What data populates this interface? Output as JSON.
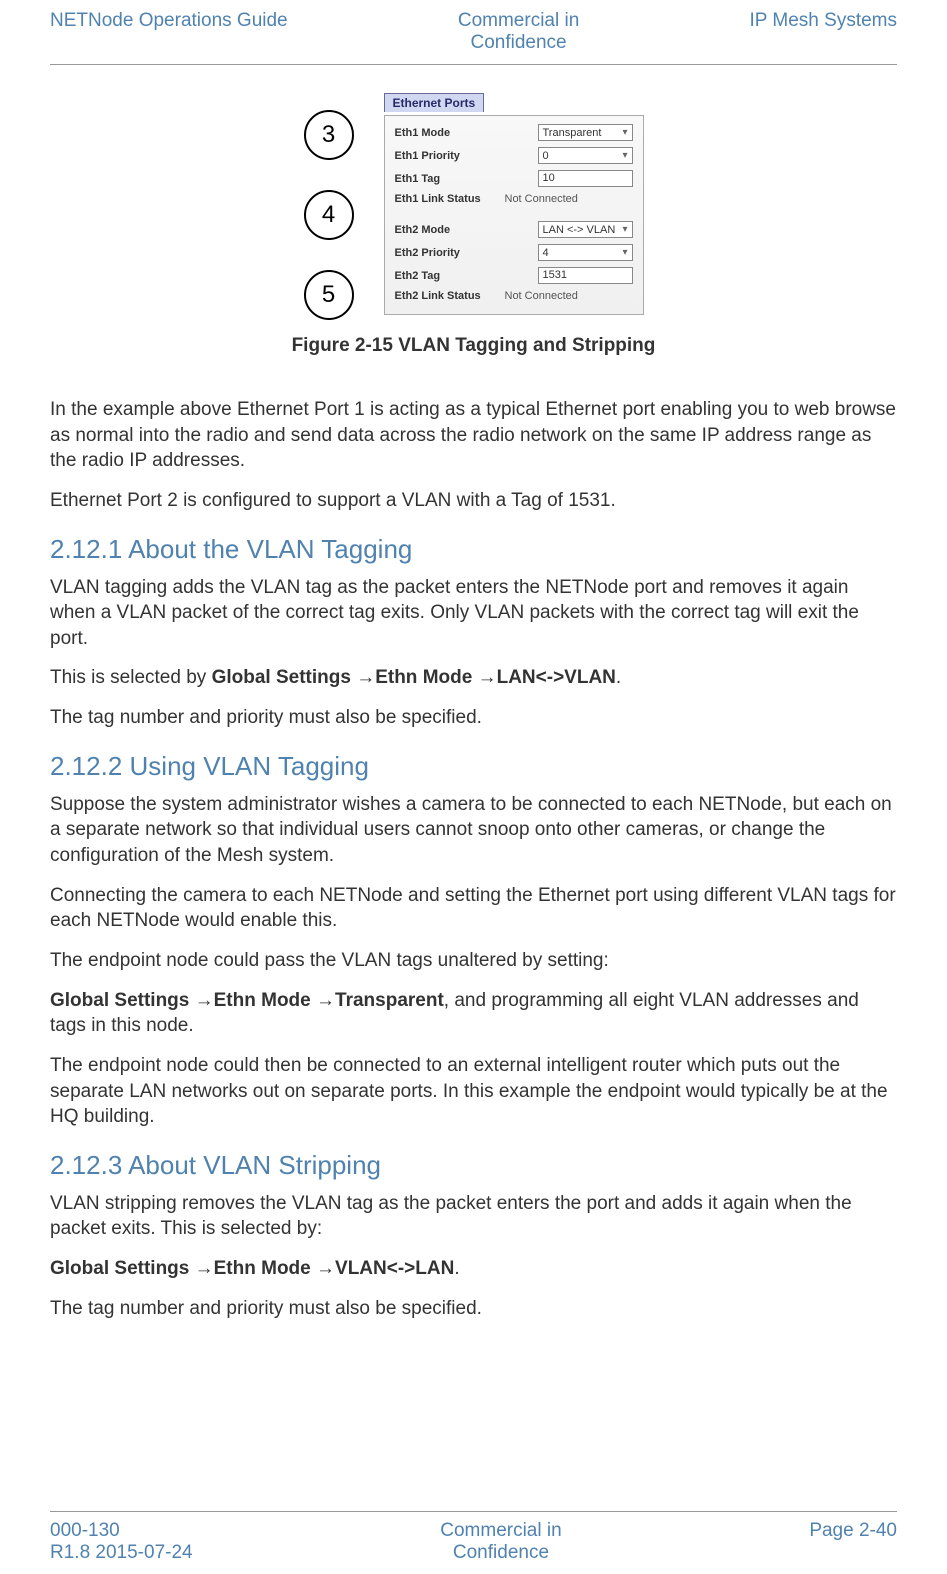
{
  "header": {
    "left": "NETNode Operations Guide",
    "center_l1": "Commercial in",
    "center_l2": "Confidence",
    "right": "IP Mesh Systems"
  },
  "figure": {
    "tab": "Ethernet Ports",
    "circle3": "3",
    "circle4": "4",
    "circle5": "5",
    "rows1": {
      "eth1_mode_label": "Eth1 Mode",
      "eth1_mode_value": "Transparent",
      "eth1_priority_label": "Eth1 Priority",
      "eth1_priority_value": "0",
      "eth1_tag_label": "Eth1 Tag",
      "eth1_tag_value": "10",
      "eth1_link_label": "Eth1 Link Status",
      "eth1_link_value": "Not Connected"
    },
    "rows2": {
      "eth2_mode_label": "Eth2 Mode",
      "eth2_mode_value": "LAN <-> VLAN",
      "eth2_priority_label": "Eth2 Priority",
      "eth2_priority_value": "4",
      "eth2_tag_label": "Eth2 Tag",
      "eth2_tag_value": "1531",
      "eth2_link_label": "Eth2 Link Status",
      "eth2_link_value": "Not Connected"
    },
    "caption": "Figure 2-15 VLAN Tagging and Stripping"
  },
  "body": {
    "p1": "In the example above Ethernet Port 1 is acting as a typical Ethernet port enabling you to web browse as normal into the radio and send data across the radio network on the same IP address range as the radio IP addresses.",
    "p2": "Ethernet Port 2 is configured to support a VLAN with a Tag of 1531.",
    "h1": "2.12.1 About the VLAN Tagging",
    "p3": "VLAN tagging adds the VLAN tag as the packet enters the NETNode port and removes it again when a VLAN packet of the correct tag exits. Only VLAN packets with the correct tag will exit the port.",
    "p4_pre": "This is selected by ",
    "p4_b1": "Global Settings ",
    "p4_arr1": "→",
    "p4_b2": "Ethn Mode ",
    "p4_arr2": "→",
    "p4_b3": "LAN<->VLAN",
    "p4_post": ".",
    "p5": "The tag number and priority must also be specified.",
    "h2": "2.12.2 Using VLAN Tagging",
    "p6": "Suppose the system administrator wishes a camera to be connected to each NETNode, but each on a separate network so that individual users cannot snoop onto other cameras, or change the configuration of the Mesh system.",
    "p7": "Connecting the camera to each NETNode and setting the Ethernet port using different VLAN tags for each NETNode would enable this.",
    "p8": "The endpoint node could pass the VLAN tags unaltered by setting:",
    "p9_b1": "Global Settings ",
    "p9_arr1": "→",
    "p9_b2": "Ethn Mode ",
    "p9_arr2": "→",
    "p9_b3": "Transparent",
    "p9_post": ", and programming all eight VLAN addresses and tags in this node.",
    "p10": "The endpoint node could then be connected to an external intelligent router which puts out the separate LAN networks out on separate ports. In this example the endpoint would typically be at the HQ building.",
    "h3": "2.12.3 About VLAN Stripping",
    "p11": "VLAN stripping removes the VLAN tag as the packet enters the port and adds it again when the packet exits. This is selected by:",
    "p12_b1": "Global Settings ",
    "p12_arr1": "→",
    "p12_b2": "Ethn Mode ",
    "p12_arr2": "→",
    "p12_b3": "VLAN<->LAN",
    "p12_post": ".",
    "p13": "The tag number and priority must also be specified."
  },
  "footer": {
    "left_l1": "000-130",
    "left_l2": "R1.8 2015-07-24",
    "center_l1": "Commercial in",
    "center_l2": "Confidence",
    "right": "Page 2-40"
  }
}
